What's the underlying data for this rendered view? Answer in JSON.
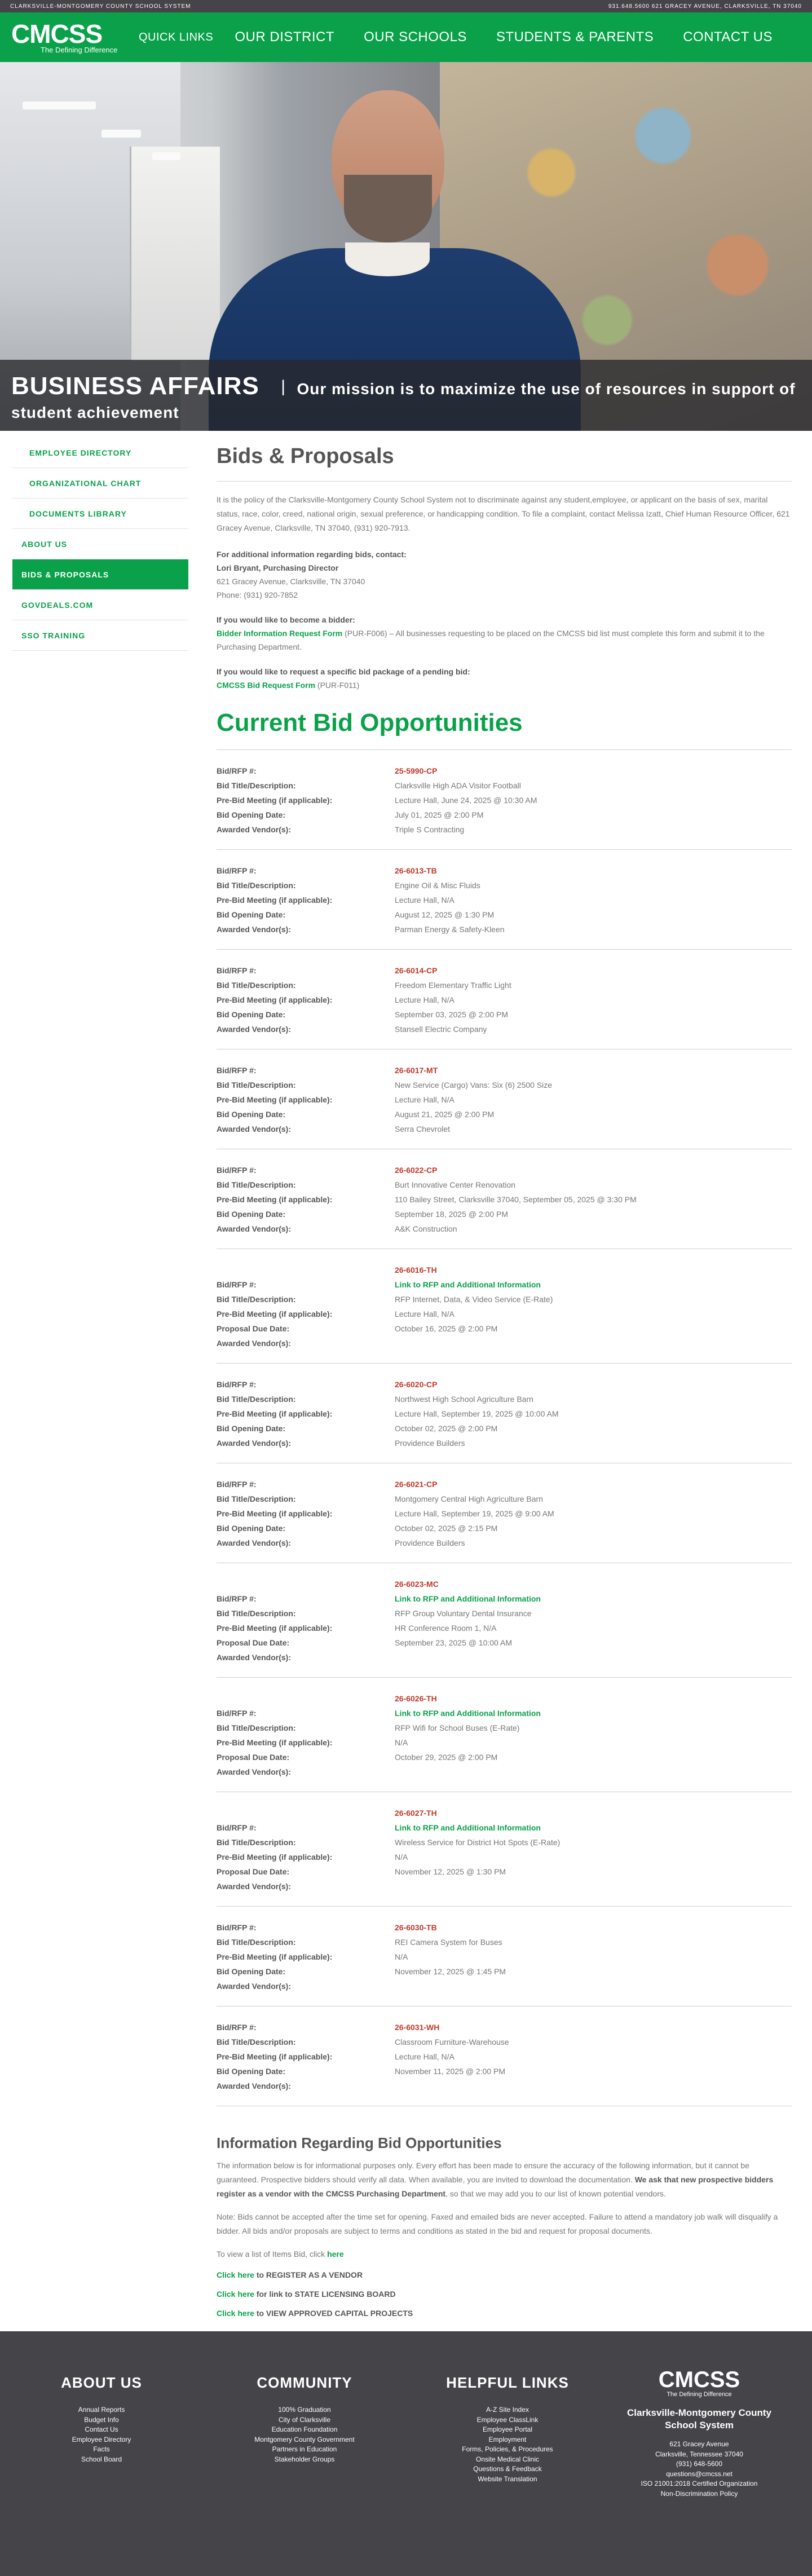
{
  "topbar": {
    "left": "CLARKSVILLE-MONTGOMERY COUNTY SCHOOL SYSTEM",
    "right": "931.648.5600   621 Gracey Avenue, Clarksville, TN 37040"
  },
  "header": {
    "logo_text": "CMCSS",
    "logo_tagline": "The Defining Difference",
    "quick_links": "QUICK LINKS",
    "nav": [
      "OUR DISTRICT",
      "OUR SCHOOLS",
      "STUDENTS & PARENTS",
      "CONTACT US"
    ]
  },
  "hero": {
    "title": "BUSINESS AFFAIRS",
    "separator": "|",
    "mission_line1": "Our mission is to maximize the use of resources in support of",
    "mission_line2": "student achievement"
  },
  "sidebar": {
    "items": [
      {
        "label": "EMPLOYEE DIRECTORY",
        "level": "sub"
      },
      {
        "label": "ORGANIZATIONAL CHART",
        "level": "sub"
      },
      {
        "label": "DOCUMENTS LIBRARY",
        "level": "sub"
      },
      {
        "label": "ABOUT US",
        "level": "top"
      },
      {
        "label": "BIDS & PROPOSALS",
        "level": "top",
        "active": true
      },
      {
        "label": "GOVDEALS.COM",
        "level": "top"
      },
      {
        "label": "SSO TRAINING",
        "level": "top"
      }
    ]
  },
  "main": {
    "title": "Bids & Proposals",
    "policy": "It is the policy of the Clarksville-Montgomery County School System not to discriminate against any student,employee, or applicant on the basis of sex, marital status, race, color, creed, national origin, sexual preference, or handicapping condition. To file a complaint, contact Melissa Izatt, Chief Human Resource Officer, 621 Gracey Avenue, Clarksville, TN 37040, (931) 920-7913.",
    "contact": {
      "heading": "For additional information regarding bids, contact:",
      "name": "Lori Bryant, Purchasing Director",
      "address": "621 Gracey Avenue, Clarksville, TN 37040",
      "phone": "Phone: (931) 920-7852"
    },
    "bidder": {
      "heading": "If you would like to become a bidder:",
      "link": "Bidder Information Request Form",
      "text": " (PUR-F006) – All businesses requesting to be placed on the CMCSS bid list must complete this form and submit it to the Purchasing Department."
    },
    "package": {
      "heading": "If you would like to request a specific bid package of a pending bid:",
      "link": "CMCSS Bid Request Form",
      "text": " (PUR-F011)"
    },
    "section_title": "Current Bid Opportunities",
    "bids": [
      {
        "rows": [
          {
            "k": "Bid/RFP #:",
            "v": "25-5990-CP",
            "num": true
          },
          {
            "k": "Bid Title/Description:",
            "v": "Clarksville High ADA Visitor Football"
          },
          {
            "k": "Pre-Bid Meeting (if applicable):",
            "v": "Lecture Hall, June 24, 2025 @ 10:30 AM"
          },
          {
            "k": "Bid Opening Date:",
            "v": "July 01, 2025 @ 2:00 PM"
          },
          {
            "k": "Awarded Vendor(s):",
            "v": "Triple S Contracting"
          }
        ]
      },
      {
        "rows": [
          {
            "k": "Bid/RFP #:",
            "v": "26-6013-TB",
            "num": true
          },
          {
            "k": "Bid Title/Description:",
            "v": "Engine Oil & Misc Fluids"
          },
          {
            "k": "Pre-Bid Meeting (if applicable):",
            "v": "Lecture Hall, N/A"
          },
          {
            "k": "Bid Opening Date:",
            "v": "August 12, 2025 @ 1:30 PM"
          },
          {
            "k": "Awarded Vendor(s):",
            "v": "Parman Energy & Safety-Kleen"
          }
        ]
      },
      {
        "rows": [
          {
            "k": "Bid/RFP #:",
            "v": "26-6014-CP",
            "num": true
          },
          {
            "k": "Bid Title/Description:",
            "v": "Freedom Elementary Traffic Light"
          },
          {
            "k": "Pre-Bid Meeting (if applicable):",
            "v": "Lecture Hall, N/A"
          },
          {
            "k": "Bid Opening Date:",
            "v": "September 03, 2025 @ 2:00 PM"
          },
          {
            "k": "Awarded Vendor(s):",
            "v": "Stansell Electric Company"
          }
        ]
      },
      {
        "rows": [
          {
            "k": "Bid/RFP #:",
            "v": "26-6017-MT",
            "num": true
          },
          {
            "k": "Bid Title/Description:",
            "v": "New Service (Cargo) Vans: Six (6) 2500 Size"
          },
          {
            "k": "Pre-Bid Meeting (if applicable):",
            "v": "Lecture Hall, N/A"
          },
          {
            "k": "Bid Opening Date:",
            "v": "August 21, 2025 @ 2:00 PM"
          },
          {
            "k": "Awarded Vendor(s):",
            "v": "Serra Chevrolet"
          }
        ]
      },
      {
        "rows": [
          {
            "k": "Bid/RFP #:",
            "v": "26-6022-CP",
            "num": true
          },
          {
            "k": "Bid Title/Description:",
            "v": "Burt Innovative Center Renovation"
          },
          {
            "k": "Pre-Bid Meeting (if applicable):",
            "v": "110 Bailey Street, Clarksville 37040, September 05, 2025 @ 3:30 PM"
          },
          {
            "k": "Bid Opening Date:",
            "v": "September 18, 2025 @ 2:00 PM"
          },
          {
            "k": "Awarded Vendor(s):",
            "v": "A&K Construction"
          }
        ]
      },
      {
        "rows": [
          {
            "k": "Bid/RFP #:",
            "v": "26-6016-TH",
            "num": true,
            "link": "Link to RFP and Additional Information"
          },
          {
            "k": "Bid Title/Description:",
            "v": "RFP Internet, Data, & Video Service (E-Rate)"
          },
          {
            "k": "Pre-Bid Meeting (if applicable):",
            "v": "Lecture Hall, N/A"
          },
          {
            "k": "Proposal Due Date:",
            "v": "October 16, 2025 @ 2:00 PM"
          },
          {
            "k": "Awarded Vendor(s):",
            "v": ""
          }
        ]
      },
      {
        "rows": [
          {
            "k": "Bid/RFP #:",
            "v": "26-6020-CP",
            "num": true
          },
          {
            "k": "Bid Title/Description:",
            "v": "Northwest High School Agriculture Barn"
          },
          {
            "k": "Pre-Bid Meeting (if applicable):",
            "v": "Lecture Hall, September 19, 2025 @ 10:00 AM"
          },
          {
            "k": "Bid Opening Date:",
            "v": "October 02, 2025 @ 2:00 PM"
          },
          {
            "k": "Awarded Vendor(s):",
            "v": "Providence Builders"
          }
        ]
      },
      {
        "rows": [
          {
            "k": "Bid/RFP #:",
            "v": "26-6021-CP",
            "num": true
          },
          {
            "k": "Bid Title/Description:",
            "v": "Montgomery Central High Agriculture Barn"
          },
          {
            "k": "Pre-Bid Meeting (if applicable):",
            "v": "Lecture Hall, September 19, 2025 @ 9:00 AM"
          },
          {
            "k": "Bid Opening Date:",
            "v": "October 02, 2025 @ 2:15 PM"
          },
          {
            "k": "Awarded Vendor(s):",
            "v": "Providence Builders"
          }
        ]
      },
      {
        "rows": [
          {
            "k": "Bid/RFP #:",
            "v": "26-6023-MC",
            "num": true,
            "link": "Link to RFP and Additional Information"
          },
          {
            "k": "Bid Title/Description:",
            "v": "RFP Group Voluntary Dental Insurance"
          },
          {
            "k": "Pre-Bid Meeting (if applicable):",
            "v": "HR Conference Room 1, N/A"
          },
          {
            "k": "Proposal Due Date:",
            "v": "September 23, 2025 @ 10:00 AM"
          },
          {
            "k": "Awarded Vendor(s):",
            "v": ""
          }
        ]
      },
      {
        "rows": [
          {
            "k": "Bid/RFP #:",
            "v": "26-6026-TH",
            "num": true,
            "link": "Link to RFP and Additional Information"
          },
          {
            "k": "Bid Title/Description:",
            "v": "RFP Wifi for School Buses (E-Rate)"
          },
          {
            "k": "Pre-Bid Meeting (if applicable):",
            "v": "N/A"
          },
          {
            "k": "Proposal Due Date:",
            "v": "October 29, 2025 @ 2:00 PM"
          },
          {
            "k": "Awarded Vendor(s):",
            "v": ""
          }
        ]
      },
      {
        "rows": [
          {
            "k": "Bid/RFP #:",
            "v": "26-6027-TH",
            "num": true,
            "link": "Link to RFP and Additional Information"
          },
          {
            "k": "Bid Title/Description:",
            "v": "Wireless Service for District Hot Spots (E-Rate)"
          },
          {
            "k": "Pre-Bid Meeting (if applicable):",
            "v": "N/A"
          },
          {
            "k": "Proposal Due Date:",
            "v": "November 12, 2025 @ 1:30 PM"
          },
          {
            "k": "Awarded Vendor(s):",
            "v": ""
          }
        ]
      },
      {
        "rows": [
          {
            "k": "Bid/RFP #:",
            "v": "26-6030-TB",
            "num": true
          },
          {
            "k": "Bid Title/Description:",
            "v": "REI Camera System for Buses"
          },
          {
            "k": "Pre-Bid Meeting (if applicable):",
            "v": "N/A"
          },
          {
            "k": "Bid Opening Date:",
            "v": "November 12, 2025 @ 1:45 PM"
          },
          {
            "k": "Awarded Vendor(s):",
            "v": ""
          }
        ]
      },
      {
        "rows": [
          {
            "k": "Bid/RFP #:",
            "v": "26-6031-WH",
            "num": true
          },
          {
            "k": "Bid Title/Description:",
            "v": "Classroom Furniture-Warehouse"
          },
          {
            "k": "Pre-Bid Meeting (if applicable):",
            "v": "Lecture Hall, N/A"
          },
          {
            "k": "Bid Opening Date:",
            "v": "November 11, 2025 @ 2:00 PM"
          },
          {
            "k": "Awarded Vendor(s):",
            "v": ""
          }
        ]
      }
    ],
    "info": {
      "title": "Information Regarding Bid Opportunities",
      "p1": "The information below is for informational purposes only. Every effort has been made to ensure the accuracy of the following information, but it cannot be guaranteed. Prospective bidders should verify all data. When available, you are invited to download the documentation. ",
      "p1_bold": "We ask that new prospective bidders register as a vendor with the CMCSS Purchasing Department",
      "p1_end": ", so that we may add you to our list of known potential vendors.",
      "p2": "Note: Bids cannot be accepted after the time set for opening. Faxed and emailed bids are never accepted. Failure to attend a mandatory job walk will disqualify a bidder. All bids and/or proposals are subject to terms and conditions as stated in the bid and request for proposal documents.",
      "p3": "To view a list of Items Bid, click ",
      "p3_link": "here"
    },
    "clicks": [
      {
        "link": "Click here",
        "text": " to REGISTER AS A VENDOR"
      },
      {
        "link": "Click here",
        "text": " for link to STATE LICENSING BOARD"
      },
      {
        "link": "Click here",
        "text": " to VIEW APPROVED CAPITAL PROJECTS"
      }
    ]
  },
  "footer": {
    "about": {
      "title": "ABOUT US",
      "items": [
        "Annual Reports",
        "Budget Info",
        "Contact Us",
        "Employee Directory",
        "Facts",
        "School Board"
      ]
    },
    "community": {
      "title": "COMMUNITY",
      "items": [
        "100% Graduation",
        "City of Clarksville",
        "Education Foundation",
        "Montgomery County Government",
        "Partners in Education",
        "Stakeholder Groups"
      ]
    },
    "helpful": {
      "title": "HELPFUL LINKS",
      "items": [
        "A-Z Site Index",
        "Employee ClassLink",
        "Employee Portal",
        "Employment",
        "Forms, Policies, & Procedures",
        "Onsite Medical Clinic",
        "Questions & Feedback",
        "Website Translation"
      ]
    },
    "org": {
      "logo_text": "CMCSS",
      "logo_tagline": "The Defining Difference",
      "name": "Clarksville-Montgomery County School System",
      "lines": [
        "621 Gracey Avenue",
        "Clarksville, Tennessee 37040",
        "(931) 648-5600",
        "questions@cmcss.net",
        "ISO 21001:2018 Certified Organization",
        "Non-Discrimination Policy"
      ]
    }
  }
}
